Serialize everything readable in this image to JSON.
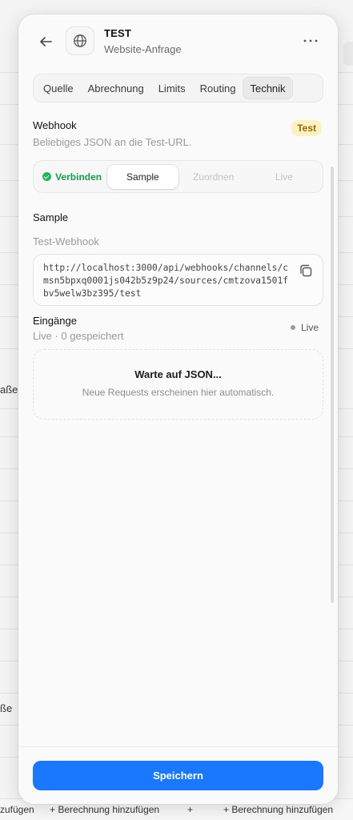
{
  "background": {
    "row_labels": [
      "aße",
      "ße"
    ],
    "bottom_bar": {
      "left_text": "zufügen",
      "middle_text": "+ Berechnung hinzufügen",
      "plus": "+",
      "right_text": "+ Berechnung hinzufügen"
    }
  },
  "header": {
    "title": "TEST",
    "subtitle": "Website-Anfrage",
    "back_icon": "arrow-left-icon",
    "app_icon": "globe-icon",
    "more_label": "···"
  },
  "tabs": [
    {
      "label": "Quelle",
      "active": false
    },
    {
      "label": "Abrechnung",
      "active": false
    },
    {
      "label": "Limits",
      "active": false
    },
    {
      "label": "Routing",
      "active": false
    },
    {
      "label": "Technik",
      "active": true
    }
  ],
  "webhook": {
    "title": "Webhook",
    "description": "Beliebiges JSON an die Test-URL.",
    "badge": "Test"
  },
  "steps": [
    {
      "label": "Verbinden",
      "state": "done"
    },
    {
      "label": "Sample",
      "state": "current"
    },
    {
      "label": "Zuordnen",
      "state": "disabled"
    },
    {
      "label": "Live",
      "state": "disabled"
    }
  ],
  "sample": {
    "title": "Sample",
    "field_label": "Test-Webhook",
    "url": "http://localhost:3000/api/webhooks/channels/cmsn5bpxq0001js042b5z9p24/sources/cmtzova1501fbv5welw3bz395/test",
    "copy_icon": "copy-icon"
  },
  "inbox": {
    "title": "Eingänge",
    "status_text": "Live · 0 gespeichert",
    "live_label": "Live",
    "empty_title": "Warte auf JSON...",
    "empty_text": "Neue Requests erscheinen hier automatisch."
  },
  "footer": {
    "save_label": "Speichern"
  },
  "colors": {
    "accent": "#1a78ff",
    "success": "#1a9c4f",
    "badge_bg": "#fdf1c4",
    "badge_text": "#9a6a00"
  }
}
